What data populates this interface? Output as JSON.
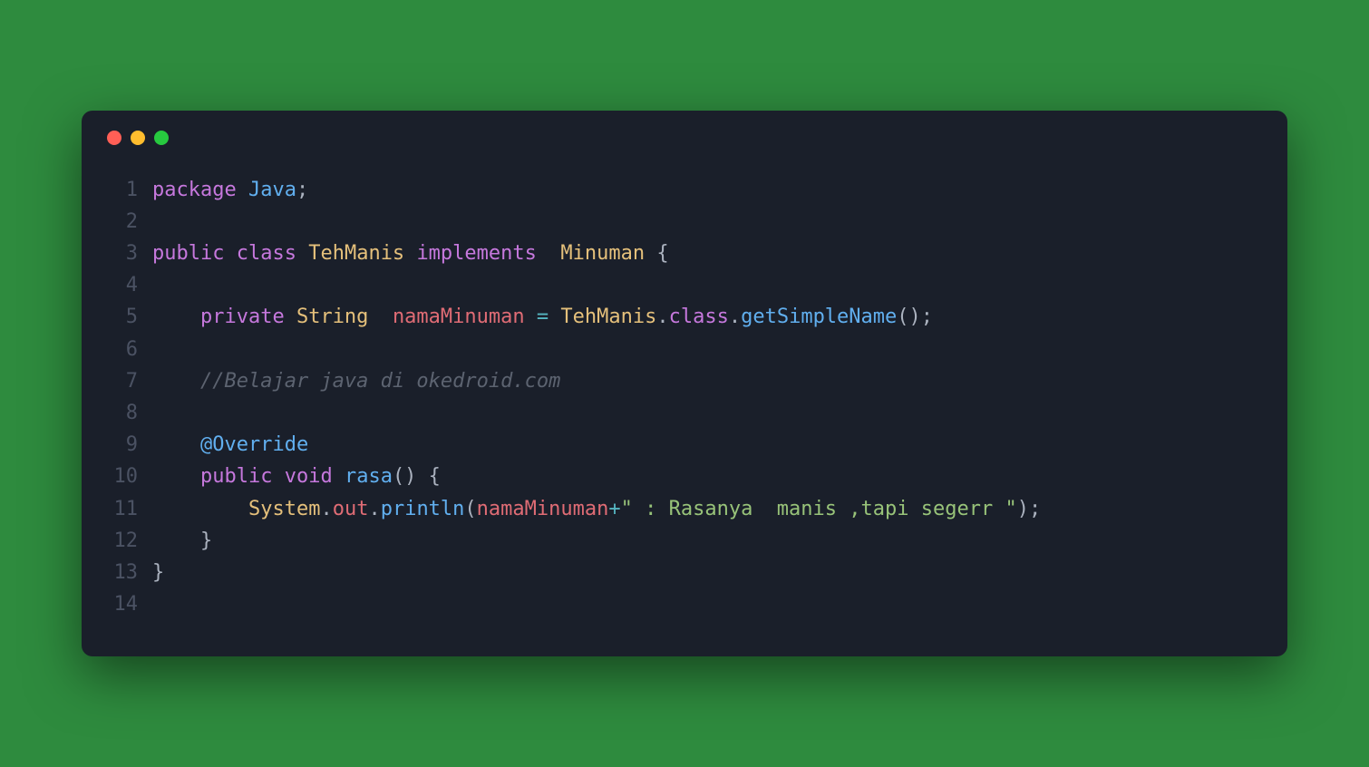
{
  "colors": {
    "bg_page": "#2e8b3e",
    "bg_window": "#1a1f2a",
    "dot_red": "#ff5f56",
    "dot_yellow": "#ffbd2e",
    "dot_green": "#27c93f",
    "keyword": "#c678dd",
    "class": "#e5c07b",
    "type": "#61afef",
    "function": "#56b6c2",
    "variable": "#e06c75",
    "string": "#98c379",
    "comment": "#5c6370",
    "lineno": "#4b5263"
  },
  "code": {
    "lines": [
      {
        "n": "1",
        "tokens": [
          {
            "t": "package",
            "c": "kw"
          },
          {
            "t": " ",
            "c": "plain"
          },
          {
            "t": "Java",
            "c": "type"
          },
          {
            "t": ";",
            "c": "punc"
          }
        ]
      },
      {
        "n": "2",
        "tokens": []
      },
      {
        "n": "3",
        "tokens": [
          {
            "t": "public",
            "c": "kw"
          },
          {
            "t": " ",
            "c": "plain"
          },
          {
            "t": "class",
            "c": "kw"
          },
          {
            "t": " ",
            "c": "plain"
          },
          {
            "t": "TehManis",
            "c": "cls"
          },
          {
            "t": " ",
            "c": "plain"
          },
          {
            "t": "implements",
            "c": "kw"
          },
          {
            "t": "  ",
            "c": "plain"
          },
          {
            "t": "Minuman",
            "c": "cls"
          },
          {
            "t": " {",
            "c": "punc"
          }
        ]
      },
      {
        "n": "4",
        "tokens": []
      },
      {
        "n": "5",
        "tokens": [
          {
            "t": "    ",
            "c": "plain"
          },
          {
            "t": "private",
            "c": "kw"
          },
          {
            "t": " ",
            "c": "plain"
          },
          {
            "t": "String",
            "c": "cls"
          },
          {
            "t": "  ",
            "c": "plain"
          },
          {
            "t": "namaMinuman",
            "c": "var"
          },
          {
            "t": " ",
            "c": "plain"
          },
          {
            "t": "=",
            "c": "op"
          },
          {
            "t": " ",
            "c": "plain"
          },
          {
            "t": "TehManis",
            "c": "cls"
          },
          {
            "t": ".",
            "c": "punc"
          },
          {
            "t": "class",
            "c": "kw"
          },
          {
            "t": ".",
            "c": "punc"
          },
          {
            "t": "getSimpleName",
            "c": "type"
          },
          {
            "t": "();",
            "c": "punc"
          }
        ]
      },
      {
        "n": "6",
        "tokens": []
      },
      {
        "n": "7",
        "tokens": [
          {
            "t": "    ",
            "c": "plain"
          },
          {
            "t": "//Belajar java di okedroid.com",
            "c": "comment"
          }
        ]
      },
      {
        "n": "8",
        "tokens": []
      },
      {
        "n": "9",
        "tokens": [
          {
            "t": "    ",
            "c": "plain"
          },
          {
            "t": "@Override",
            "c": "ann"
          }
        ]
      },
      {
        "n": "10",
        "tokens": [
          {
            "t": "    ",
            "c": "plain"
          },
          {
            "t": "public",
            "c": "kw"
          },
          {
            "t": " ",
            "c": "plain"
          },
          {
            "t": "void",
            "c": "kw"
          },
          {
            "t": " ",
            "c": "plain"
          },
          {
            "t": "rasa",
            "c": "type"
          },
          {
            "t": "() {",
            "c": "punc"
          }
        ]
      },
      {
        "n": "11",
        "tokens": [
          {
            "t": "        ",
            "c": "plain"
          },
          {
            "t": "System",
            "c": "cls"
          },
          {
            "t": ".",
            "c": "punc"
          },
          {
            "t": "out",
            "c": "var"
          },
          {
            "t": ".",
            "c": "punc"
          },
          {
            "t": "println",
            "c": "type"
          },
          {
            "t": "(",
            "c": "punc"
          },
          {
            "t": "namaMinuman",
            "c": "var"
          },
          {
            "t": "+",
            "c": "op"
          },
          {
            "t": "\" : Rasanya  manis ,tapi segerr \"",
            "c": "str"
          },
          {
            "t": ");",
            "c": "punc"
          }
        ]
      },
      {
        "n": "12",
        "tokens": [
          {
            "t": "    }",
            "c": "punc"
          }
        ]
      },
      {
        "n": "13",
        "tokens": [
          {
            "t": "}",
            "c": "punc"
          }
        ]
      },
      {
        "n": "14",
        "tokens": []
      }
    ]
  }
}
